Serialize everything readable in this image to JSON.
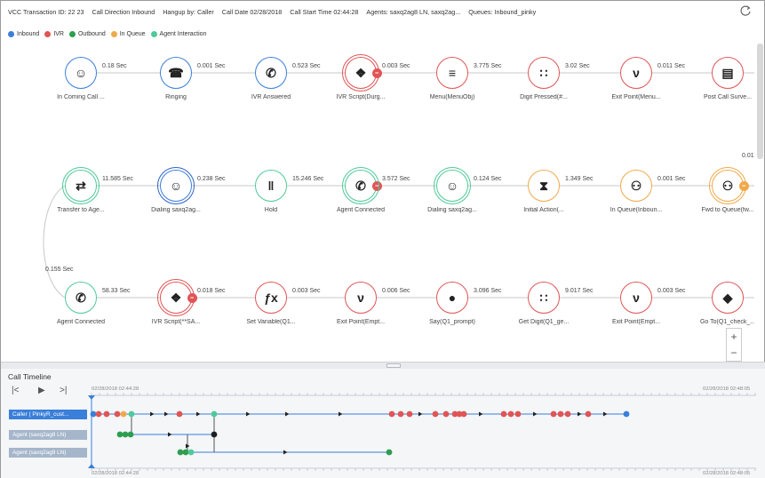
{
  "header": {
    "transaction": "VCC Transaction ID: 22 23",
    "call_direction": "Call Direction Inbound",
    "hangup_by": "Hangup by: Caller",
    "call_date": "Call Date 02/28/2018",
    "call_start": "Call Start Time 02:44:28",
    "agents": "Agents: saxq2ag8 LN, saxq2ag...",
    "queues": "Queues: Inbound_pinky",
    "refresh_icon": "refresh-icon"
  },
  "legend": [
    {
      "label": "Inbound",
      "color": "#3b7fd9"
    },
    {
      "label": "IVR",
      "color": "#e05555"
    },
    {
      "label": "Outbound",
      "color": "#2e9e4f"
    },
    {
      "label": "In Queue",
      "color": "#f0a94a"
    },
    {
      "label": "Agent Interaction",
      "color": "#4fc99a"
    }
  ],
  "flow": {
    "row1": [
      {
        "label": "In Coming Call ...",
        "type": "inbound",
        "icon": "agent-icon"
      },
      {
        "label": "Ringing",
        "type": "inbound",
        "icon": "phone-ring-icon"
      },
      {
        "label": "IVR Answered",
        "type": "inbound",
        "icon": "phone-icon"
      },
      {
        "label": "IVR Script(Durg...",
        "type": "ivr",
        "icon": "script-icon"
      },
      {
        "label": "Menu(MenuObj)",
        "type": "ivr",
        "icon": "menu-icon"
      },
      {
        "label": "Digit Pressed(#...",
        "type": "ivr",
        "icon": "keypad-icon"
      },
      {
        "label": "Exit Point(Menu...",
        "type": "ivr",
        "icon": "exit-icon"
      },
      {
        "label": "Post Call Surve...",
        "type": "ivr",
        "icon": "survey-icon"
      }
    ],
    "row1_durations": [
      "0.18 Sec",
      "0.001 Sec",
      "0.523 Sec",
      "0.003 Sec",
      "3.775 Sec",
      "3.02 Sec",
      "0.011 Sec"
    ],
    "row2": [
      {
        "label": "Transfer to Age...",
        "type": "agent",
        "icon": "transfer-icon"
      },
      {
        "label": "Dialing saxq2ag...",
        "type": "inbound",
        "icon": "agent-icon"
      },
      {
        "label": "Hold",
        "type": "agent",
        "icon": "pause-icon"
      },
      {
        "label": "Agent Connected",
        "type": "agent",
        "icon": "phone-icon"
      },
      {
        "label": "Dialing saxq2ag...",
        "type": "agent",
        "icon": "agent-icon"
      },
      {
        "label": "Initial Action(...",
        "type": "queue",
        "icon": "hourglass-icon"
      },
      {
        "label": "In Queue(Inboun...",
        "type": "queue",
        "icon": "group-icon"
      },
      {
        "label": "Fwd to Queue(fw...",
        "type": "queue",
        "icon": "group-forward-icon"
      }
    ],
    "row2_durations": [
      "11.585 Sec",
      "0.238 Sec",
      "15.246 Sec",
      "3.572 Sec",
      "0.124 Sec",
      "1.349 Sec",
      "0.001 Sec"
    ],
    "row2_edge_label": "0.01",
    "connector_label": "0.155 Sec",
    "row3": [
      {
        "label": "Agent Connected",
        "type": "agent",
        "icon": "phone-icon"
      },
      {
        "label": "IVR Script(**SA...",
        "type": "ivr",
        "icon": "script-icon"
      },
      {
        "label": "Set Variable(Q1...",
        "type": "ivr",
        "icon": "fx-icon"
      },
      {
        "label": "Exit Point(Empt...",
        "type": "ivr",
        "icon": "exit-icon"
      },
      {
        "label": "Say(Q1_prompt)",
        "type": "ivr",
        "icon": "speech-icon"
      },
      {
        "label": "Get Digit(Q1_ge...",
        "type": "ivr",
        "icon": "keypad-icon"
      },
      {
        "label": "Exit Point(Empt...",
        "type": "ivr",
        "icon": "exit-icon"
      },
      {
        "label": "Go To(Q1_check_...",
        "type": "ivr",
        "icon": "goto-icon"
      }
    ],
    "row3_durations": [
      "58.33 Sec",
      "0.018 Sec",
      "0.003 Sec",
      "0.006 Sec",
      "3.096 Sec",
      "9.017 Sec",
      "0.003 Sec"
    ]
  },
  "zoom": {
    "plus": "+",
    "minus": "−"
  },
  "timeline": {
    "title": "Call Timeline",
    "buttons": {
      "first": "|<",
      "play": "▶",
      "last": ">|"
    },
    "start_time": "02/28/2018 02:44:28",
    "end_time": "02/28/2018 02:48:05",
    "tracks": [
      {
        "label": "Caller ( PinkyR_cust...",
        "active": true
      },
      {
        "label": "Agent (saxq2ag8 LN)",
        "active": false
      },
      {
        "label": "Agent (saxq2ag9 LN)",
        "active": false
      }
    ]
  }
}
